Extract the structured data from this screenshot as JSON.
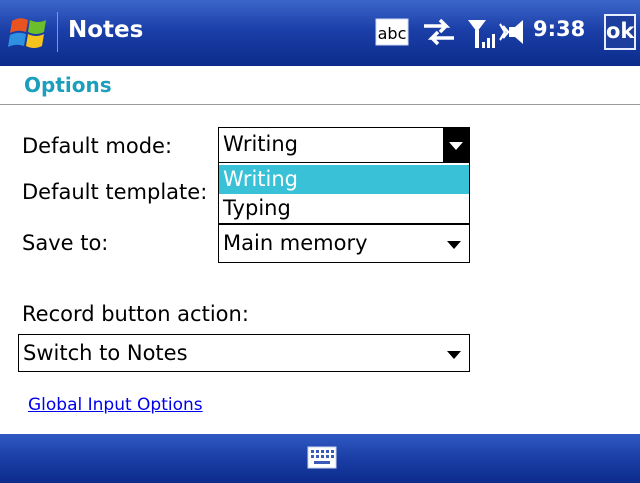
{
  "titlebar": {
    "app_title": "Notes",
    "clock": "9:38",
    "ok_label": "ok",
    "icons": [
      "windows-start-icon",
      "input-abc-icon",
      "sync-arrows-icon",
      "signal-strength-icon",
      "volume-icon"
    ],
    "input_indicator": "abc"
  },
  "page": {
    "heading": "Options",
    "accent_color": "#1c9ebd",
    "selection_color": "#39c2d7"
  },
  "fields": {
    "default_mode": {
      "label": "Default mode:",
      "value": "Writing",
      "options": [
        "Writing",
        "Typing"
      ]
    },
    "default_template": {
      "label": "Default template:"
    },
    "save_to": {
      "label": "Save to:",
      "value": "Main memory"
    },
    "record_button_action": {
      "label": "Record button action:",
      "value": "Switch to Notes"
    }
  },
  "links": {
    "global_input_options": "Global Input Options"
  },
  "bottombar": {
    "icons": [
      "keyboard-icon"
    ]
  }
}
